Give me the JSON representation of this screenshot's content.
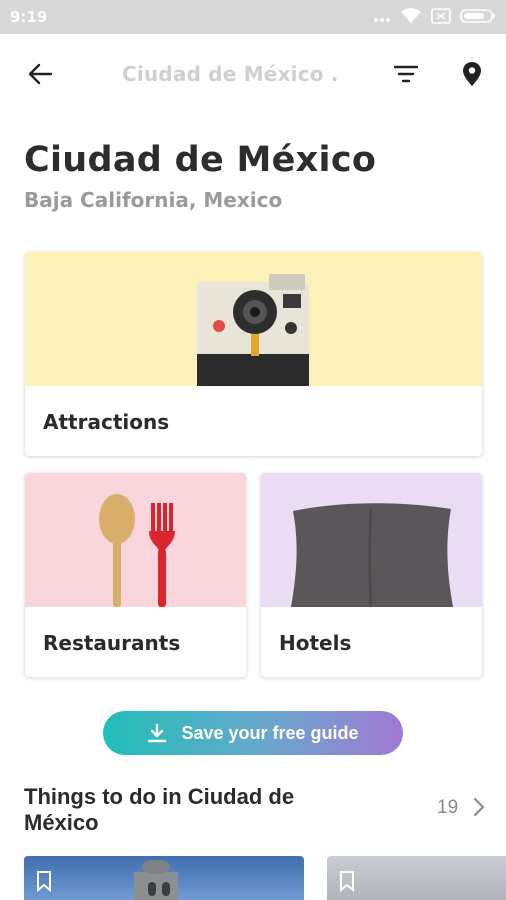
{
  "status_bar": {
    "time": "9:19",
    "icons": [
      "more-dots-icon",
      "wifi-icon",
      "sim-icon",
      "battery-icon"
    ]
  },
  "app_bar": {
    "title": "Ciudad de México .",
    "icons": [
      "back-arrow-icon",
      "filter-icon",
      "location-pin-icon"
    ]
  },
  "header": {
    "title": "Ciudad de México",
    "subtitle": "Baja California, Mexico"
  },
  "categories": [
    {
      "label": "Attractions",
      "image": "camera-illustration"
    },
    {
      "label": "Restaurants",
      "image": "spoon-fork-illustration"
    },
    {
      "label": "Hotels",
      "image": "pillow-illustration"
    }
  ],
  "save_guide": {
    "label": "Save your free guide",
    "icon": "download-icon"
  },
  "things_to_do": {
    "title": "Things to do in Ciudad de México",
    "count": "19"
  },
  "colors": {
    "attractions_bg": "#fcf1b8",
    "restaurants_bg": "#fbd5dc",
    "hotels_bg": "#e9dcf3",
    "gradient_start": "#1fbfb8",
    "gradient_end": "#a079d4"
  }
}
